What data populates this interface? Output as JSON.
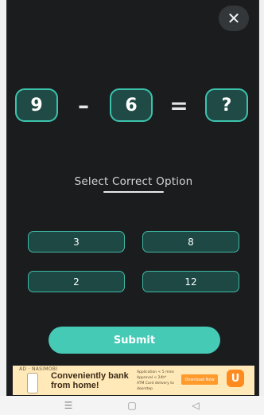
{
  "close": {
    "glyph": "✕"
  },
  "equation": {
    "left_operand": "9",
    "operator": "–",
    "right_operand": "6",
    "equals": "=",
    "answer": "?"
  },
  "prompt": {
    "text": "Select Correct Option"
  },
  "options": [
    "3",
    "8",
    "2",
    "12"
  ],
  "submit": {
    "label": "Submit"
  },
  "ad": {
    "brand": "AD · NASIMOBI",
    "headline": "Conveniently bank from home!",
    "bullets": [
      "Application < 5 mins",
      "Approval < 24h*",
      "ATM Card delivery to doorstep"
    ],
    "cta": "Download Now",
    "logo": "U"
  },
  "navbar": {
    "menu_glyph": "☰",
    "home_glyph": "▢",
    "back_glyph": "◁"
  },
  "colors": {
    "accent": "#45cab6",
    "option_border": "#3fb9a5",
    "background": "#1b1c1e"
  }
}
